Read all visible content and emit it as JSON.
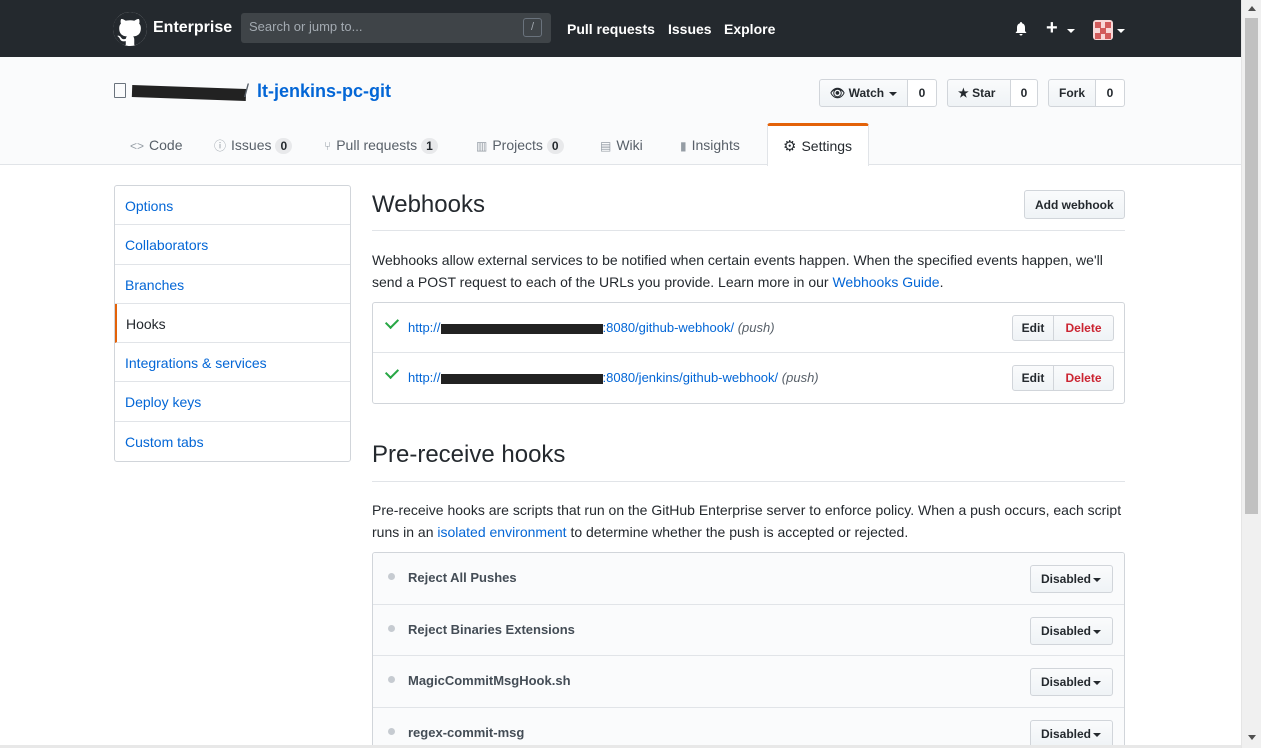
{
  "header": {
    "brand": "Enterprise",
    "search_placeholder": "Search or jump to...",
    "search_shortcut": "/",
    "nav": [
      "Pull requests",
      "Issues",
      "Explore"
    ],
    "plus": "+"
  },
  "repo": {
    "separator": "/",
    "name": "lt-jenkins-pc-git",
    "watch_label": "Watch",
    "watch_count": "0",
    "star_label": "Star",
    "star_count": "0",
    "fork_label": "Fork",
    "fork_count": "0",
    "tabs": [
      {
        "icon": "<>",
        "label": "Code",
        "count": ""
      },
      {
        "icon": "ⓘ",
        "label": "Issues",
        "count": "0"
      },
      {
        "icon": "⑂",
        "label": "Pull requests",
        "count": "1"
      },
      {
        "icon": "▥",
        "label": "Projects",
        "count": "0"
      },
      {
        "icon": "▤",
        "label": "Wiki",
        "count": ""
      },
      {
        "icon": "▮",
        "label": "Insights",
        "count": ""
      },
      {
        "icon": "⚙",
        "label": "Settings",
        "count": ""
      }
    ]
  },
  "sidebar": {
    "items": [
      "Options",
      "Collaborators",
      "Branches",
      "Hooks",
      "Integrations & services",
      "Deploy keys",
      "Custom tabs"
    ],
    "selected": "Hooks"
  },
  "webhooks": {
    "title": "Webhooks",
    "add_button": "Add webhook",
    "desc_before_link": "Webhooks allow external services to be notified when certain events happen. When the specified events happen, we'll send a POST request to each of the URLs you provide. Learn more in our ",
    "desc_link": "Webhooks Guide",
    "desc_after_link": ".",
    "hooks": [
      {
        "url_start": "http://",
        "url_end": ":8080/github-webhook/",
        "event": "(push)"
      },
      {
        "url_start": "http://",
        "url_end": ":8080/jenkins/github-webhook/",
        "event": "(push)"
      }
    ],
    "edit_label": "Edit",
    "delete_label": "Delete"
  },
  "prereceive": {
    "title": "Pre-receive hooks",
    "desc_before_link": "Pre-receive hooks are scripts that run on the GitHub Enterprise server to enforce policy. When a push occurs, each script runs in an ",
    "desc_link": "isolated environment",
    "desc_after_link": " to determine whether the push is accepted or rejected.",
    "hooks": [
      {
        "name": "Reject All Pushes",
        "status": "Disabled"
      },
      {
        "name": "Reject Binaries Extensions",
        "status": "Disabled"
      },
      {
        "name": "MagicCommitMsgHook.sh",
        "status": "Disabled"
      },
      {
        "name": "regex-commit-msg",
        "status": "Disabled"
      }
    ]
  },
  "colors": {
    "header_bg": "#24292e",
    "link": "#0366d6",
    "accent_orange": "#e36209",
    "delete_red": "#cb2431",
    "check_green": "#28a745"
  }
}
